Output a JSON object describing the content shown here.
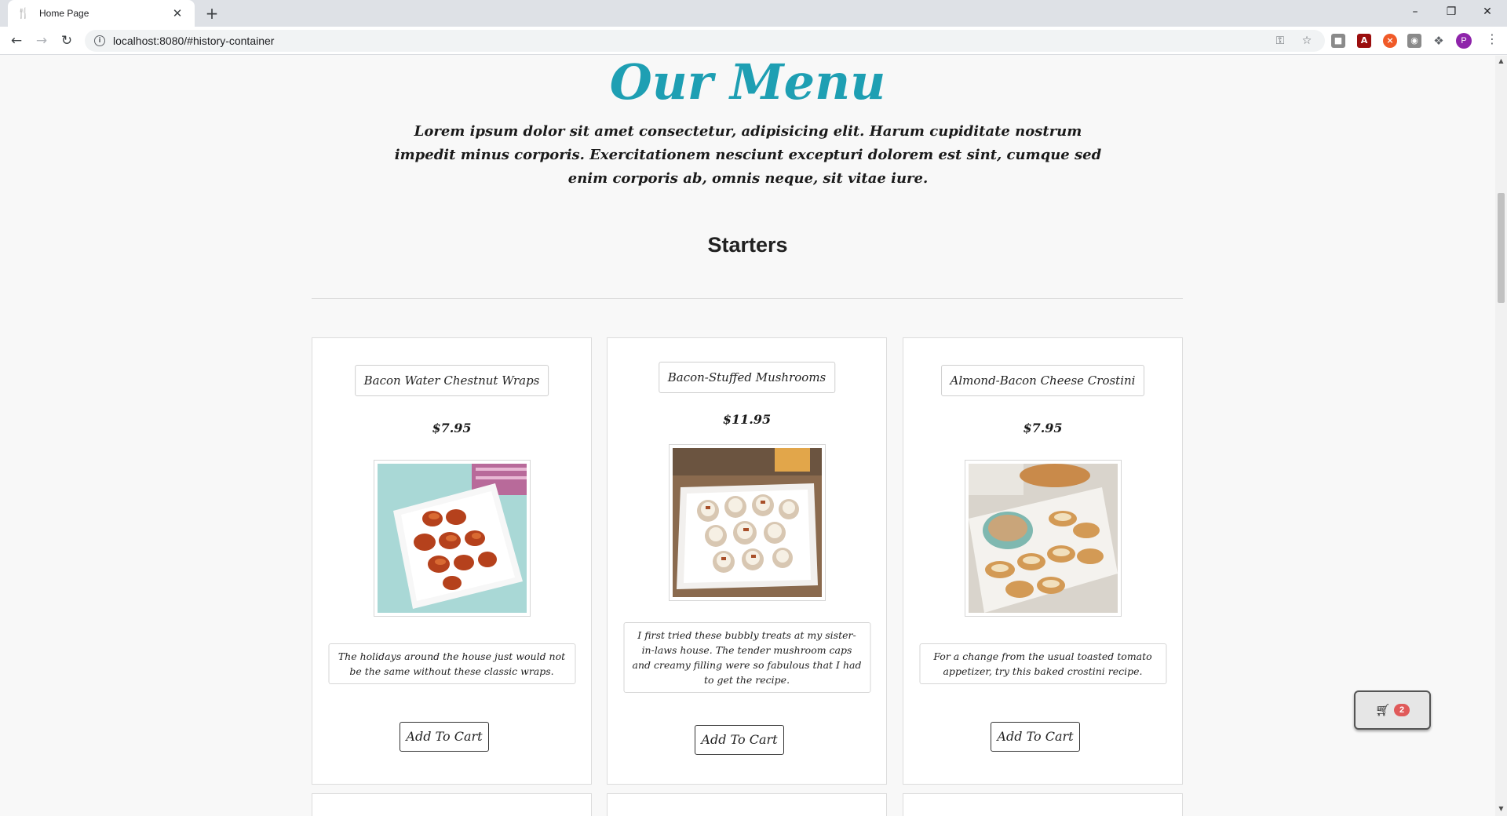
{
  "browser": {
    "tab_title": "Home Page",
    "url": "localhost:8080/#history-container",
    "profile_initial": "P"
  },
  "page": {
    "title": "Our Menu",
    "intro": "Lorem ipsum dolor sit amet consectetur, adipisicing elit. Harum cupiditate nostrum impedit minus corporis. Exercitationem nesciunt excepturi dolorem est sint, cumque sed enim corporis ab, omnis neque, sit vitae iure.",
    "section": "Starters",
    "title_color": "#1e9fb3"
  },
  "items": [
    {
      "name": "Bacon Water Chestnut Wraps",
      "price": "$7.95",
      "description": "The holidays around the house just would not be the same without these classic wraps.",
      "button": "Add To Cart"
    },
    {
      "name": "Bacon-Stuffed Mushrooms",
      "price": "$11.95",
      "description": "I first tried these bubbly treats at my sister-in-laws house. The tender mushroom caps and creamy filling were so fabulous that I had to get the recipe.",
      "button": "Add To Cart"
    },
    {
      "name": "Almond-Bacon Cheese Crostini",
      "price": "$7.95",
      "description": "For a change from the usual toasted tomato appetizer, try this baked crostini recipe.",
      "button": "Add To Cart"
    }
  ],
  "cart": {
    "count": "2"
  }
}
